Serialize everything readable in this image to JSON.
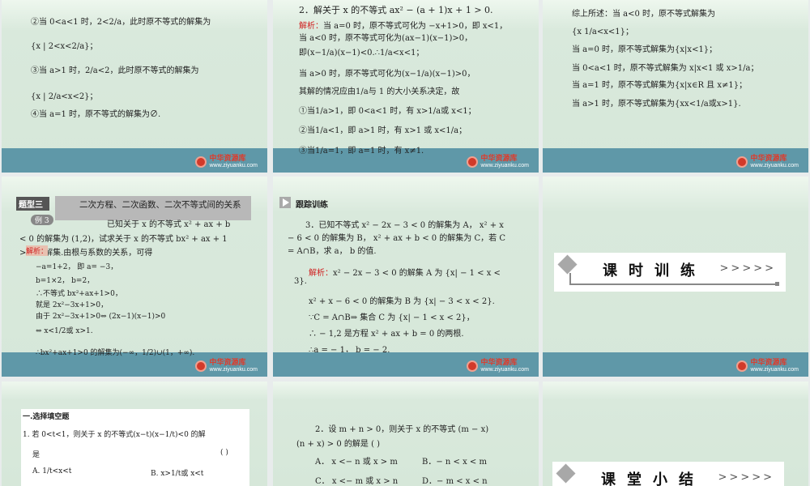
{
  "logo": {
    "name": "中华资源库",
    "url": "www.ziyuanku.com"
  },
  "slides": [
    {
      "lines": [
        "②当 0<a<1 时，2<2/a，此时原不等式的解集为",
        "{x | 2<x<2/a}；",
        "③当 a>1 时，2/a<2，此时原不等式的解集为",
        "{x | 2/a<x<2}；",
        "④当 a=1 时，原不等式的解集为∅."
      ]
    },
    {
      "lines": [
        "2．解关于 x 的不等式 ax² − (a + 1)x + 1 > 0.",
        "当 a=0 时，原不等式可化为 −x+1>0，即 x<1，",
        "当 a<0 时，原不等式可化为(ax−1)(x−1)>0，",
        "即(x−1/a)(x−1)<0.∴1/a<x<1；",
        "当 a>0 时，原不等式可化为(x−1/a)(x−1)>0，",
        "其解的情况应由1/a与 1 的大小关系决定，故",
        "①当1/a>1，即 0<a<1 时，有 x>1/a或 x<1；",
        "②当1/a<1，即 a>1 时，有 x>1 或 x<1/a；",
        "③当1/a=1，即 a=1 时，有 x≠1."
      ],
      "label": "解析："
    },
    {
      "lines": [
        "综上所述：当 a<0 时，原不等式解集为",
        "{x 1/a<x<1}；",
        "当 a=0 时，原不等式解集为{x|x<1}；",
        "当 0<a<1 时，原不等式解集为 x|x<1 或 x>1/a；",
        "当 a=1 时，原不等式解集为{x|x∈R 且 x≠1}；",
        "当 a>1 时，原不等式解集为{xx<1/a或x>1}."
      ]
    },
    {
      "tag": "题型三",
      "title": "二次方程、二次函数、二次不等式间的关系",
      "example": "例 3",
      "label": "解析：",
      "lines": [
        "已知关于 x 的不等式 x² + ax + b",
        "< 0 的解集为 (1,2)，试求关于 x 的不等式 bx² + ax + 1",
        "> 0 的解集.由根与系数的关系，可得",
        "−a=1+2，      即 a= −3，",
        "b=1×2，            b=2，",
        "∴不等式 bx²+ax+1>0，",
        "就是 2x²−3x+1>0，",
        "由于 2x²−3x+1>0⇔ (2x−1)(x−1)>0",
        "⇔ x<1/2或 x>1.",
        "∴bx²+ax+1>0 的解集为(−∞，1/2)∪(1，+∞)."
      ]
    },
    {
      "heading": "跟踪训练",
      "label": "解析：",
      "lines": [
        "3．已知不等式 x² − 2x − 3 < 0 的解集为 A， x² + x",
        "− 6 < 0 的解集为 B， x² + ax + b < 0 的解集为 C，若 C",
        "= A∩B，求 a， b 的值.",
        "x² − 2x − 3 < 0 的解集 A 为 {x| − 1 < x <",
        "3}.",
        "x² + x − 6 < 0 的解集为 B 为 {x| − 3 < x < 2}.",
        "∵C = A∩B⇒ 集合 C 为 {x| − 1 < x < 2}，",
        "∴ − 1,2 是方程 x² + ax + b = 0 的两根.",
        "∴a = − 1， b = − 2."
      ]
    },
    {
      "title": "课时训练",
      "arrows": ">>>>>"
    },
    {
      "section": "一.选择填空题",
      "lines": [
        "1. 若 0<t<1，则关于 x 的不等式(x−t)(x−1/t)<0 的解",
        "是",
        "(      )",
        "A. 1/t<x<t",
        "B. x>1/t或 x<t"
      ]
    },
    {
      "lines": [
        "2．设 m + n > 0，则关于 x 的不等式 (m − x)",
        "(n + x) > 0 的解是 (        )",
        "A．  x <− n 或 x > m",
        "B．− n < x < m",
        "C．  x <− m 或 x > n",
        "D．− m < x < n"
      ]
    },
    {
      "title": "课堂小结",
      "arrows": ">>>>>"
    }
  ]
}
